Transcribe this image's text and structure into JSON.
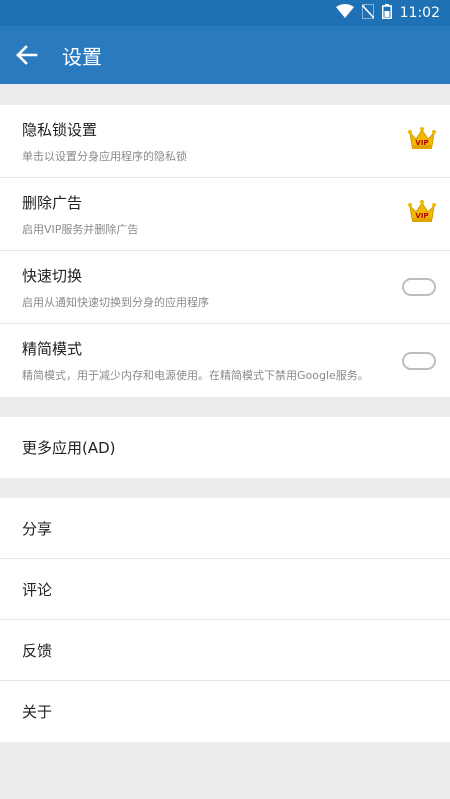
{
  "status_bar": {
    "time": "11:02",
    "icons": [
      "wifi-icon",
      "no-sim-icon",
      "battery-icon"
    ]
  },
  "toolbar": {
    "title": "设置",
    "back_icon": "arrow-left-icon"
  },
  "settings_section": {
    "items": [
      {
        "title": "隐私锁设置",
        "subtitle": "单击以设置分身应用程序的隐私锁",
        "badge": "VIP"
      },
      {
        "title": "删除广告",
        "subtitle": "启用VIP服务并删除广告",
        "badge": "VIP"
      },
      {
        "title": "快速切换",
        "subtitle": "启用从通知快速切换到分身的应用程序",
        "toggle": "off"
      },
      {
        "title": "精简模式",
        "subtitle": "精简模式，用于减少内存和电源使用。在精简模式下禁用Google服务。",
        "toggle": "off"
      }
    ]
  },
  "apps_section": {
    "items": [
      {
        "title": "更多应用(AD)"
      }
    ]
  },
  "misc_section": {
    "items": [
      {
        "title": "分享"
      },
      {
        "title": "评论"
      },
      {
        "title": "反馈"
      },
      {
        "title": "关于"
      }
    ]
  },
  "colors": {
    "status_bar": "#1f71b5",
    "toolbar": "#2a7ac0",
    "background": "#ececec",
    "crown": "#f3b800"
  }
}
